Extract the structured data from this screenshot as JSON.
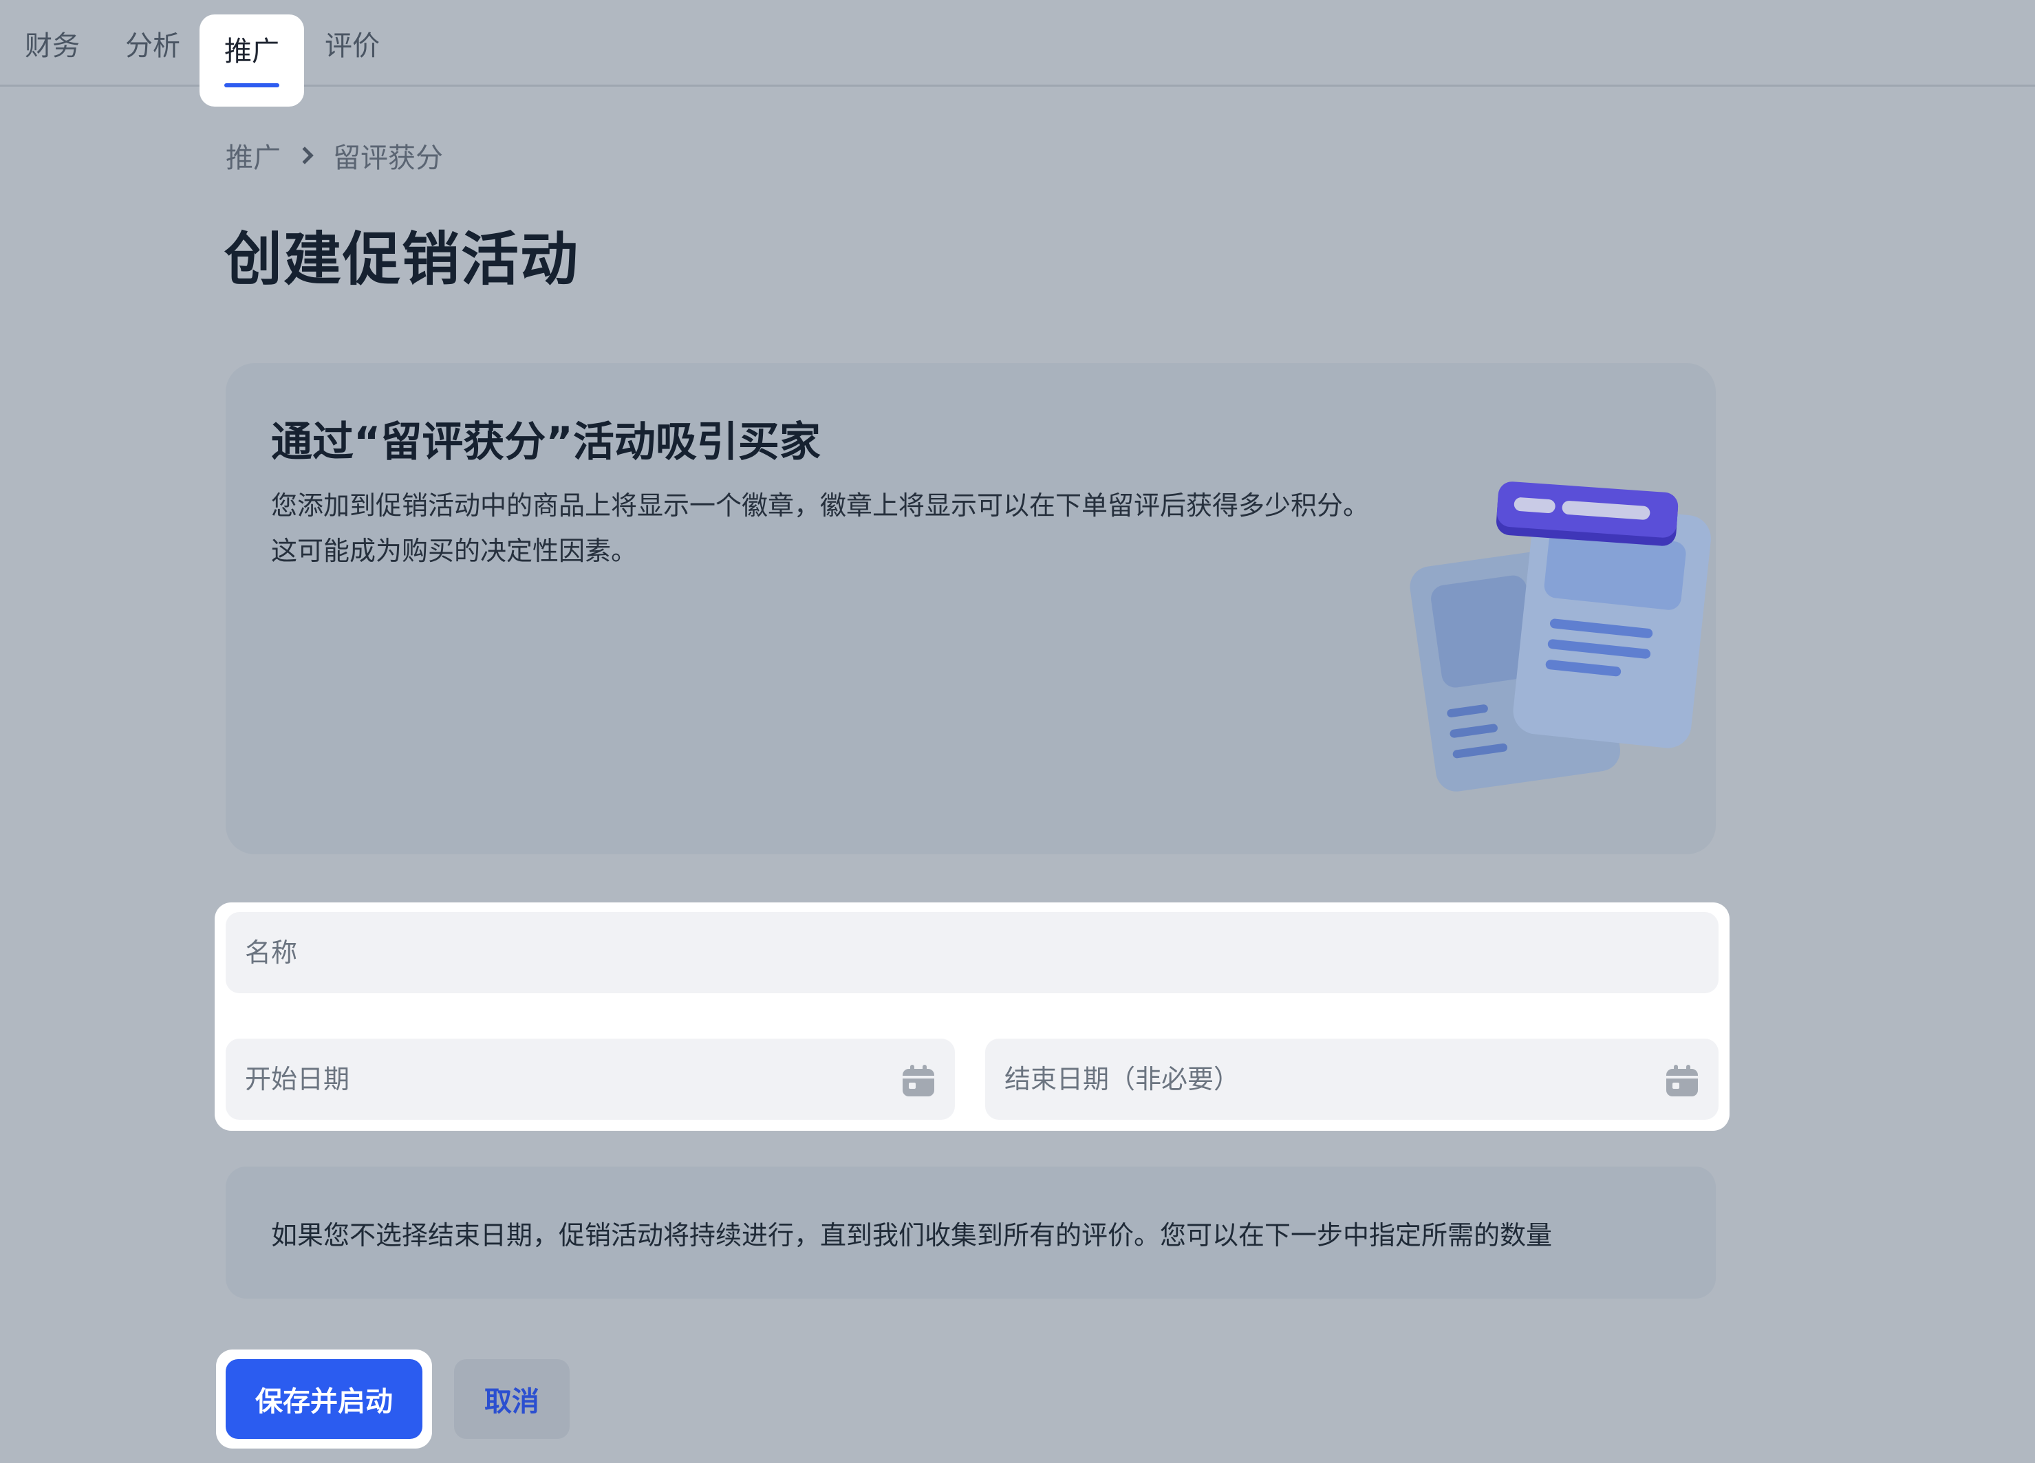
{
  "tabs": [
    {
      "label": "财务",
      "active": false
    },
    {
      "label": "分析",
      "active": false
    },
    {
      "label": "推广",
      "active": true
    },
    {
      "label": "评价",
      "active": false
    }
  ],
  "breadcrumb": {
    "parent": "推广",
    "current": "留评获分"
  },
  "page_title": "创建促销活动",
  "info_card": {
    "title": "通过“留评获分”活动吸引买家",
    "description": "您添加到促销活动中的商品上将显示一个徽章，徽章上将显示可以在下单留评后获得多少积分。这可能成为购买的决定性因素。",
    "illustration_icon": "document-badge-illustration"
  },
  "form": {
    "name_placeholder": "名称",
    "start_date_placeholder": "开始日期",
    "end_date_placeholder": "结束日期（非必要）",
    "calendar_icon": "calendar-icon"
  },
  "note": "如果您不选择结束日期，促销活动将持续进行，直到我们收集到所有的评价。您可以在下一步中指定所需的数量",
  "buttons": {
    "save": "保存并启动",
    "cancel": "取消"
  },
  "colors": {
    "page_background": "#b1b8c1",
    "accent": "#2b5cf0",
    "card_background": "#a9b2bd",
    "field_background": "#f1f2f5"
  }
}
